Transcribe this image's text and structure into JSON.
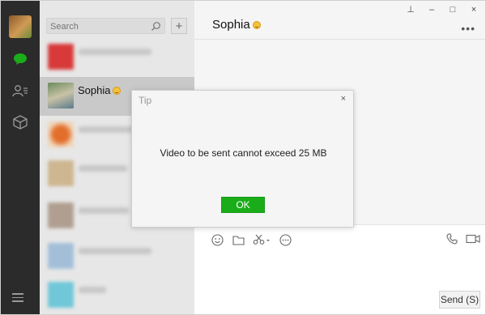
{
  "search": {
    "placeholder": "Search"
  },
  "list": {
    "add_label": "+",
    "selected_contact": "Sophia"
  },
  "chat": {
    "title": "Sophia",
    "send_label": "Send (S)"
  },
  "dialog": {
    "title": "Tip",
    "message": "Video to be sent cannot exceed 25 MB",
    "ok_label": "OK",
    "close_glyph": "×"
  },
  "window_controls": {
    "pin": "⊥",
    "minimize": "–",
    "maximize": "□",
    "close": "×"
  },
  "more_glyph": "•••",
  "colors": {
    "rail": "#2b2b2b",
    "list_bg": "#e7e7e7",
    "selected_row": "#c9c9c9",
    "chat_bg": "#f5f5f5",
    "accent_green": "#1aad19"
  },
  "icons": {
    "rail": [
      "avatar",
      "chat-bubble-icon",
      "contacts-icon",
      "favorites-box-icon",
      "menu-icon"
    ],
    "toolbar": [
      "emoji-icon",
      "folder-icon",
      "scissors-icon",
      "chat-history-icon"
    ],
    "toolbar_right": [
      "phone-icon",
      "video-call-icon"
    ]
  }
}
